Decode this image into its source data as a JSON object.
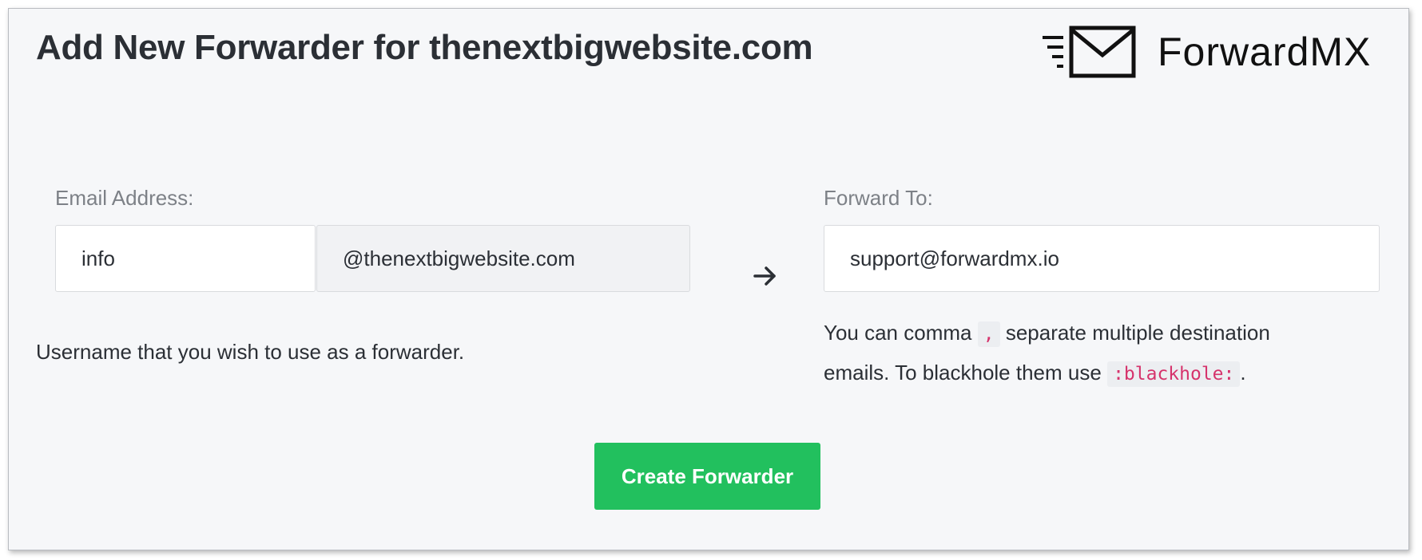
{
  "header": {
    "title": "Add New Forwarder for thenextbigwebsite.com",
    "logo_text": "ForwardMX",
    "logo_icon": "envelope-speed-icon"
  },
  "form": {
    "email_label": "Email Address:",
    "username_value": "info",
    "domain_suffix": "@thenextbigwebsite.com",
    "username_help": "Username that you wish to use as a forwarder.",
    "arrow_icon": "arrow-right-icon",
    "forward_label": "Forward To:",
    "forward_value": "support@forwardmx.io",
    "forward_help_part1": "You can comma",
    "forward_help_code1": ",",
    "forward_help_part2": "separate multiple destination emails. To blackhole them use",
    "forward_help_code2": ":blackhole:",
    "forward_help_part3": ".",
    "submit_label": "Create Forwarder"
  },
  "colors": {
    "primary_button": "#22c05e",
    "code_text": "#d6336c",
    "panel_background": "#f6f7f9"
  }
}
